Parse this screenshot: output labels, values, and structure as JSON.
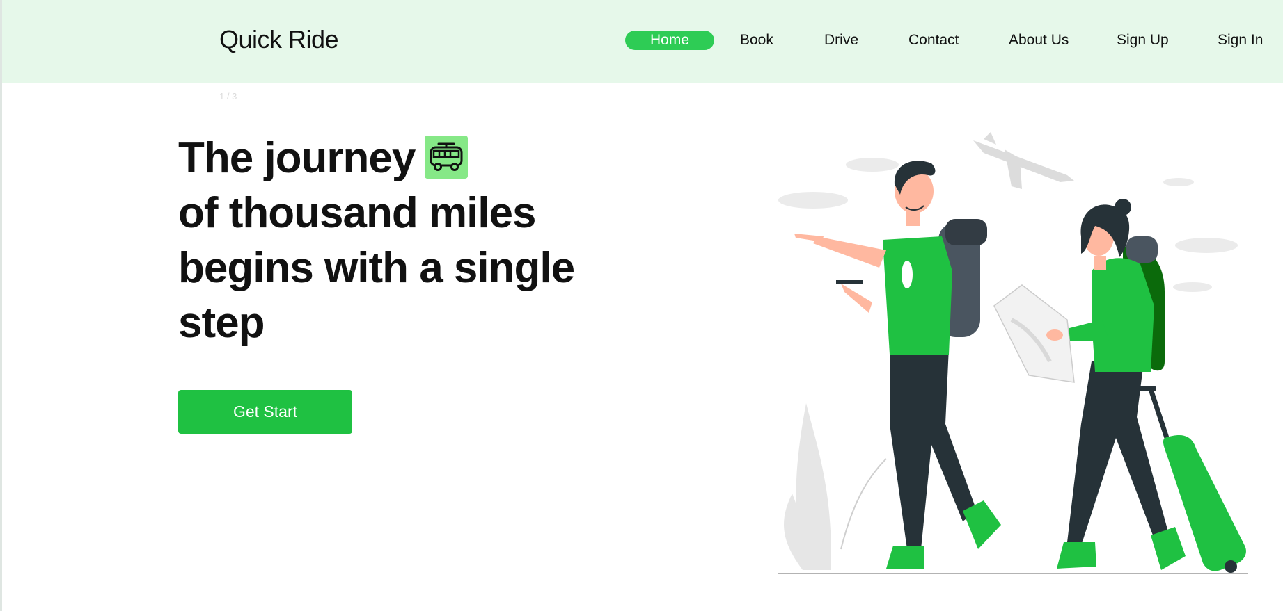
{
  "brand": {
    "name": "Quick Ride"
  },
  "nav": {
    "items": [
      {
        "label": "Home",
        "active": true
      },
      {
        "label": "Book"
      },
      {
        "label": "Drive"
      },
      {
        "label": "Contact"
      },
      {
        "label": "About Us"
      },
      {
        "label": "Sign Up"
      },
      {
        "label": "Sign In"
      }
    ]
  },
  "hero": {
    "slide_indicator": "1 / 3",
    "headline_lines": [
      "The journey",
      "of thousand miles",
      "begins with a single",
      "step"
    ],
    "cta_label": "Get Start",
    "icon": "bus-icon"
  },
  "colors": {
    "nav_background": "#e6f8ea",
    "accent": "#1fc142",
    "active_pill": "#2ecc55",
    "bus_badge": "#86e887"
  },
  "illustration": {
    "icon": "travelers-illustration"
  }
}
